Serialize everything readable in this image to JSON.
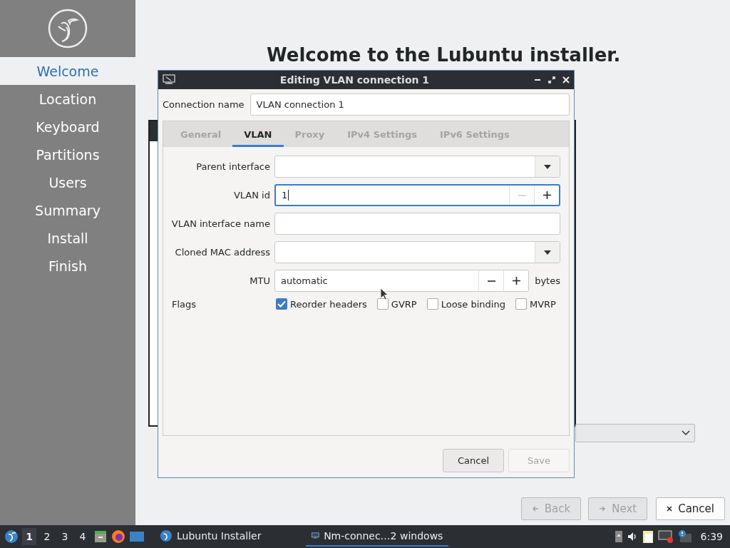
{
  "sidebar": {
    "items": [
      {
        "label": "Welcome",
        "selected": true
      },
      {
        "label": "Location",
        "selected": false
      },
      {
        "label": "Keyboard",
        "selected": false
      },
      {
        "label": "Partitions",
        "selected": false
      },
      {
        "label": "Users",
        "selected": false
      },
      {
        "label": "Summary",
        "selected": false
      },
      {
        "label": "Install",
        "selected": false
      },
      {
        "label": "Finish",
        "selected": false
      }
    ]
  },
  "heading": "Welcome to the Lubuntu installer.",
  "dialog": {
    "title": "Editing VLAN connection 1",
    "connection_name_label": "Connection name",
    "connection_name": "VLAN connection 1",
    "tabs": [
      {
        "label": "General",
        "selected": false
      },
      {
        "label": "VLAN",
        "selected": true
      },
      {
        "label": "Proxy",
        "selected": false
      },
      {
        "label": "IPv4 Settings",
        "selected": false
      },
      {
        "label": "IPv6 Settings",
        "selected": false
      }
    ],
    "fields": [
      {
        "kind": "combo",
        "label": "Parent interface"
      },
      {
        "kind": "spin",
        "label": "VLAN id",
        "value": "1",
        "focused": true,
        "minus_disabled": true
      },
      {
        "kind": "text",
        "label": "VLAN interface name"
      },
      {
        "kind": "combo",
        "label": "Cloned MAC address"
      },
      {
        "kind": "spin",
        "label": "MTU",
        "value": "automatic",
        "focused": false,
        "minus_disabled": false,
        "suffix": "bytes"
      }
    ],
    "flags_label": "Flags",
    "flags": [
      {
        "label": "Reorder headers",
        "checked": true
      },
      {
        "label": "GVRP",
        "checked": false
      },
      {
        "label": "Loose binding",
        "checked": false
      },
      {
        "label": "MVRP",
        "checked": false
      }
    ],
    "buttons": [
      {
        "label": "Cancel",
        "disabled": false
      },
      {
        "label": "Save",
        "disabled": true
      }
    ]
  },
  "nav_buttons": [
    {
      "kind": "back",
      "label": "Back",
      "disabled": true
    },
    {
      "kind": "next",
      "label": "Next",
      "disabled": true
    },
    {
      "kind": "cancel",
      "label": "Cancel",
      "disabled": false
    }
  ],
  "taskbar": {
    "workspaces": [
      {
        "label": "1",
        "selected": true
      },
      {
        "label": "2",
        "selected": false
      },
      {
        "label": "3",
        "selected": false
      },
      {
        "label": "4",
        "selected": false
      }
    ],
    "tasks": [
      {
        "kind": "installer",
        "label": "Lubuntu Installer",
        "selected": false
      },
      {
        "kind": "network",
        "label": "Nm-connec…2 windows",
        "selected": true
      }
    ],
    "clock": "6:39"
  }
}
